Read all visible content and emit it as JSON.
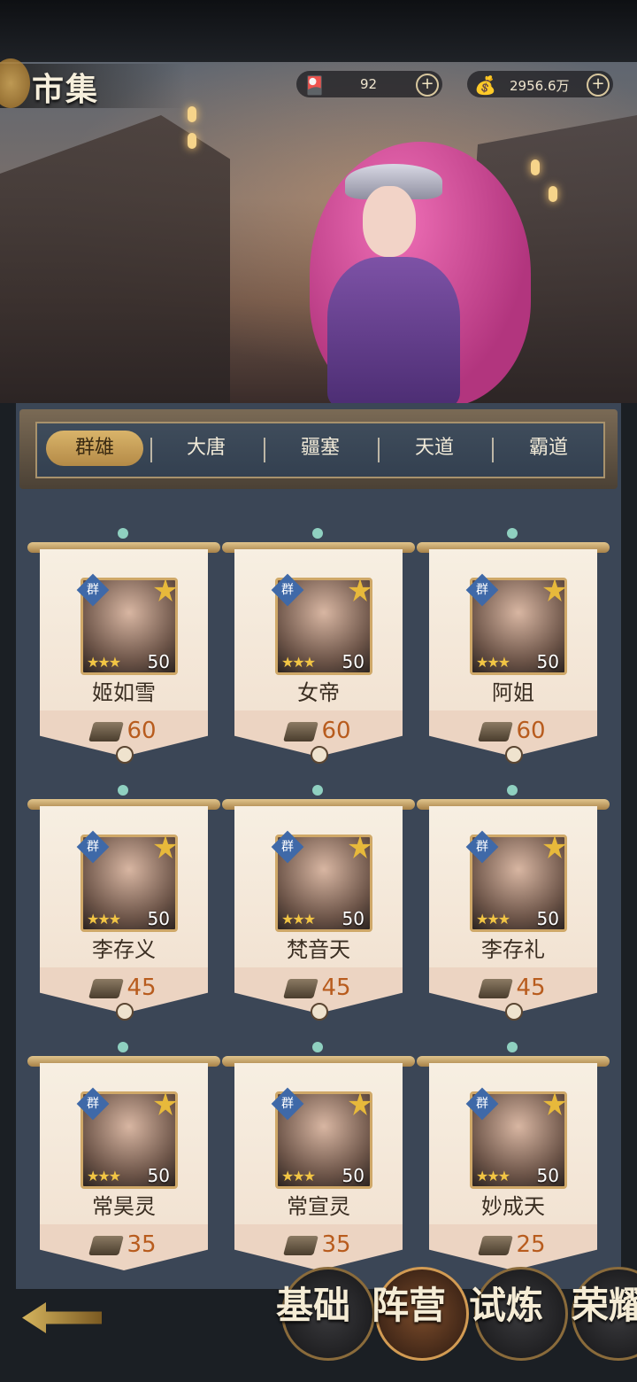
{
  "header": {
    "title": "市集",
    "resource1": {
      "icon": "scroll-token-icon",
      "value": "92",
      "plus": "+"
    },
    "resource2": {
      "icon": "coin-pouch-icon",
      "value": "2956.6万",
      "plus": "+"
    }
  },
  "tabs": [
    {
      "label": "群雄",
      "active": true
    },
    {
      "label": "大唐",
      "active": false
    },
    {
      "label": "疆塞",
      "active": false
    },
    {
      "label": "天道",
      "active": false
    },
    {
      "label": "霸道",
      "active": false
    }
  ],
  "cards": [
    {
      "name": "姬如雪",
      "faction": "群",
      "level": "50",
      "stars": "★★★",
      "price": "60"
    },
    {
      "name": "女帝",
      "faction": "群",
      "level": "50",
      "stars": "★★★",
      "price": "60"
    },
    {
      "name": "阿姐",
      "faction": "群",
      "level": "50",
      "stars": "★★★",
      "price": "60"
    },
    {
      "name": "李存义",
      "faction": "群",
      "level": "50",
      "stars": "★★★",
      "price": "45"
    },
    {
      "name": "梵音天",
      "faction": "群",
      "level": "50",
      "stars": "★★★",
      "price": "45"
    },
    {
      "name": "李存礼",
      "faction": "群",
      "level": "50",
      "stars": "★★★",
      "price": "45"
    },
    {
      "name": "常昊灵",
      "faction": "群",
      "level": "50",
      "stars": "★★★",
      "price": "35"
    },
    {
      "name": "常宣灵",
      "faction": "群",
      "level": "50",
      "stars": "★★★",
      "price": "35"
    },
    {
      "name": "妙成天",
      "faction": "群",
      "level": "50",
      "stars": "★★★",
      "price": "25"
    }
  ],
  "bottom_nav": [
    {
      "label": "基础",
      "active": false
    },
    {
      "label": "阵营",
      "active": true
    },
    {
      "label": "试炼",
      "active": false
    },
    {
      "label": "荣耀",
      "active": false
    }
  ]
}
